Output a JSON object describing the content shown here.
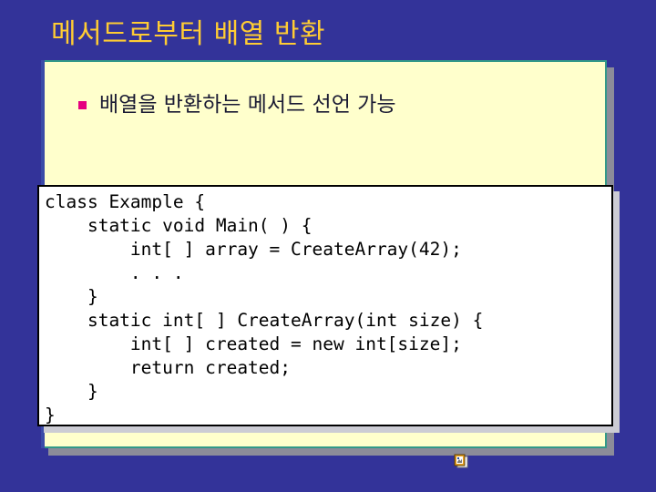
{
  "slide": {
    "title": "메서드로부터 배열 반환",
    "background_color": "#333399",
    "title_color": "#ffcc33"
  },
  "content_panel": {
    "background_color": "#ffffcc",
    "border_color": "#339988",
    "bullets": [
      {
        "marker": "square-bullet",
        "marker_color": "#e5007f",
        "text": "배열을 반환하는 메서드 선언 가능"
      }
    ]
  },
  "code_box": {
    "background_color": "#ffffff",
    "border_color": "#000000",
    "text_color": "#000000",
    "lines": [
      "class Example {",
      "    static void Main( ) {",
      "        int[ ] array = CreateArray(42);",
      "        . . .",
      "    }",
      "    static int[ ] CreateArray(int size) {",
      "        int[ ] created = new int[size];",
      "        return created;",
      "    }",
      "}"
    ],
    "code": "class Example {\n    static void Main( ) {\n        int[ ] array = CreateArray(42);\n        . . .\n    }\n    static int[ ] CreateArray(int size) {\n        int[ ] created = new int[size];\n        return created;\n    }\n}"
  },
  "footer": {
    "ole_icon": "embedded-object-icon"
  }
}
